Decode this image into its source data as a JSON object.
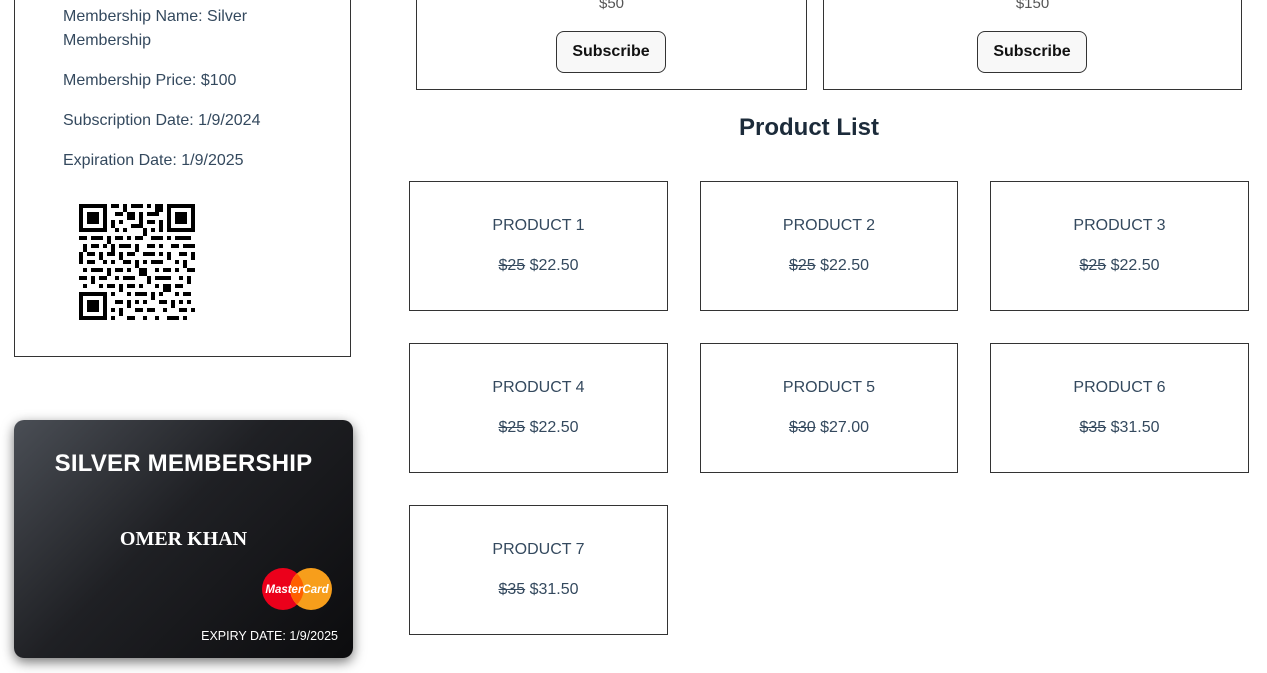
{
  "membership_info": {
    "name_text": "Membership Name: Silver Membership",
    "price_text": "Membership Price: $100",
    "subscription_date_text": "Subscription Date: 1/9/2024",
    "expiration_date_text": "Expiration Date: 1/9/2025"
  },
  "card": {
    "title": "SILVER MEMBERSHIP",
    "holder": "OMER KHAN",
    "logo_text": "MasterCard",
    "expiry": "EXPIRY DATE: 1/9/2025"
  },
  "plans": [
    {
      "price": "$50",
      "button_label": "Subscribe"
    },
    {
      "price": "$150",
      "button_label": "Subscribe"
    }
  ],
  "product_list": {
    "title": "Product List",
    "products": [
      {
        "name": "PRODUCT 1",
        "old_price": "$25",
        "new_price": "$22.50"
      },
      {
        "name": "PRODUCT 2",
        "old_price": "$25",
        "new_price": "$22.50"
      },
      {
        "name": "PRODUCT 3",
        "old_price": "$25",
        "new_price": "$22.50"
      },
      {
        "name": "PRODUCT 4",
        "old_price": "$25",
        "new_price": "$22.50"
      },
      {
        "name": "PRODUCT 5",
        "old_price": "$30",
        "new_price": "$27.00"
      },
      {
        "name": "PRODUCT 6",
        "old_price": "$35",
        "new_price": "$31.50"
      },
      {
        "name": "PRODUCT 7",
        "old_price": "$35",
        "new_price": "$31.50"
      }
    ]
  },
  "colors": {
    "text": "#34495e",
    "heading": "#1c2b3a",
    "card_dark": "#0c0c0e",
    "mc_red": "#eb001b",
    "mc_orange": "#f79e1b"
  }
}
